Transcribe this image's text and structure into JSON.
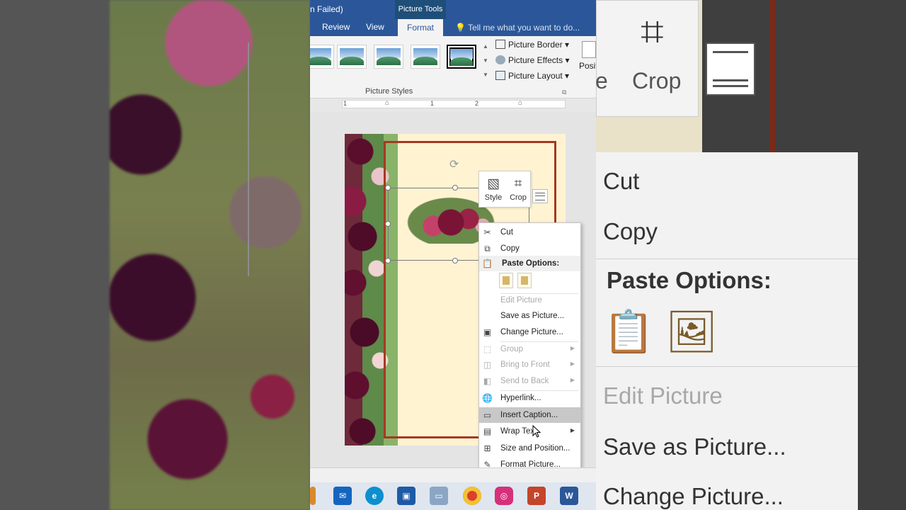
{
  "window": {
    "title_fragment": "n Failed)",
    "contextual_tab_group": "Picture Tools"
  },
  "tabs": [
    {
      "label": "Review"
    },
    {
      "label": "View"
    },
    {
      "label": "Format",
      "active": true
    }
  ],
  "tell_me": {
    "placeholder": "Tell me what you want to do..."
  },
  "ribbon": {
    "picture_styles_group": "Picture Styles",
    "commands": {
      "picture_border": "Picture Border",
      "picture_effects": "Picture Effects",
      "picture_layout": "Picture Layout",
      "position": "Positi"
    }
  },
  "ruler": {
    "numbers": [
      "1",
      "1",
      "2"
    ]
  },
  "mini_toolbar": {
    "style": "Style",
    "crop": "Crop"
  },
  "context_menu": {
    "items": [
      {
        "label": "Cut",
        "icon": "scissors-icon",
        "enabled": true
      },
      {
        "label": "Copy",
        "icon": "copy-icon",
        "enabled": true
      },
      {
        "label": "Paste Options:",
        "icon": "paste-icon",
        "header": true
      },
      {
        "label": "Edit Picture",
        "enabled": false
      },
      {
        "label": "Save as Picture...",
        "enabled": true
      },
      {
        "label": "Change Picture...",
        "icon": "change-picture-icon",
        "enabled": true
      },
      {
        "label": "Group",
        "icon": "group-icon",
        "enabled": false,
        "submenu": true
      },
      {
        "label": "Bring to Front",
        "icon": "bring-front-icon",
        "enabled": false,
        "submenu": true
      },
      {
        "label": "Send to Back",
        "icon": "send-back-icon",
        "enabled": false,
        "submenu": true
      },
      {
        "label": "Hyperlink...",
        "icon": "hyperlink-icon",
        "enabled": true
      },
      {
        "label": "Insert Caption...",
        "icon": "caption-icon",
        "enabled": true,
        "highlighted": true
      },
      {
        "label": "Wrap Text",
        "icon": "wrap-text-icon",
        "enabled": true,
        "submenu": true
      },
      {
        "label": "Size and Position...",
        "icon": "size-position-icon",
        "enabled": true
      },
      {
        "label": "Format Picture...",
        "icon": "format-picture-icon",
        "enabled": true
      }
    ]
  },
  "background_right": {
    "crop": "Crop",
    "e_fragment": "e",
    "cut": "Cut",
    "copy": "Copy",
    "paste_options": "Paste Options:",
    "edit_picture": "Edit Picture",
    "save_as_picture": "Save as Picture...",
    "change_picture": "Change Picture..."
  },
  "taskbar": {
    "apps": [
      "mail-icon",
      "edge-icon",
      "store-icon",
      "computer-icon",
      "chrome-icon",
      "instagram-icon",
      "powerpoint-icon",
      "word-icon"
    ]
  },
  "colors": {
    "word_blue": "#2b579a",
    "frame_red": "#a33a22",
    "page_cream": "#fff3d2"
  }
}
